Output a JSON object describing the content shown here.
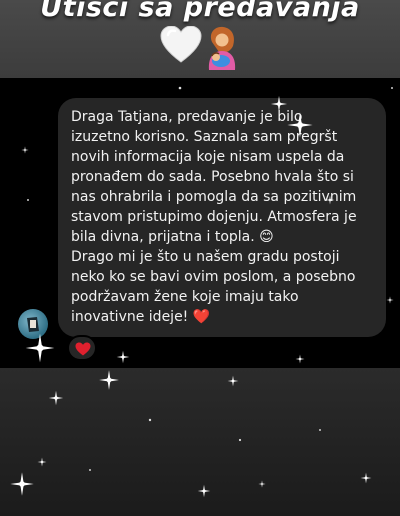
{
  "story": {
    "title": "Utisci sa predavanja",
    "title_icons": [
      "white-heart-icon",
      "breastfeeding-icon"
    ]
  },
  "message": {
    "lines": [
      "Draga Tatjana, predavanje je bilo",
      "izuzetno korisno. Saznala sam pregršt",
      "novih informacija koje nisam uspela da",
      "pronađem do sada. Posebno hvala što si",
      "nas ohrabrila i pomogla da sa pozitivnim",
      "stavom pristupimo dojenju. Atmosfera je",
      "bila divna, prijatna i topla. 😊",
      "Drago mi je što u našem gradu postoji",
      "neko ko se bavi ovim poslom, a posebno",
      "podržavam žene koje imaju tako",
      "inovativne ideje! ❤️"
    ],
    "reaction": "red-heart-icon"
  },
  "colors": {
    "bubble": "#262626",
    "chat_background": "#000000",
    "heart_red": "#e0202e"
  }
}
